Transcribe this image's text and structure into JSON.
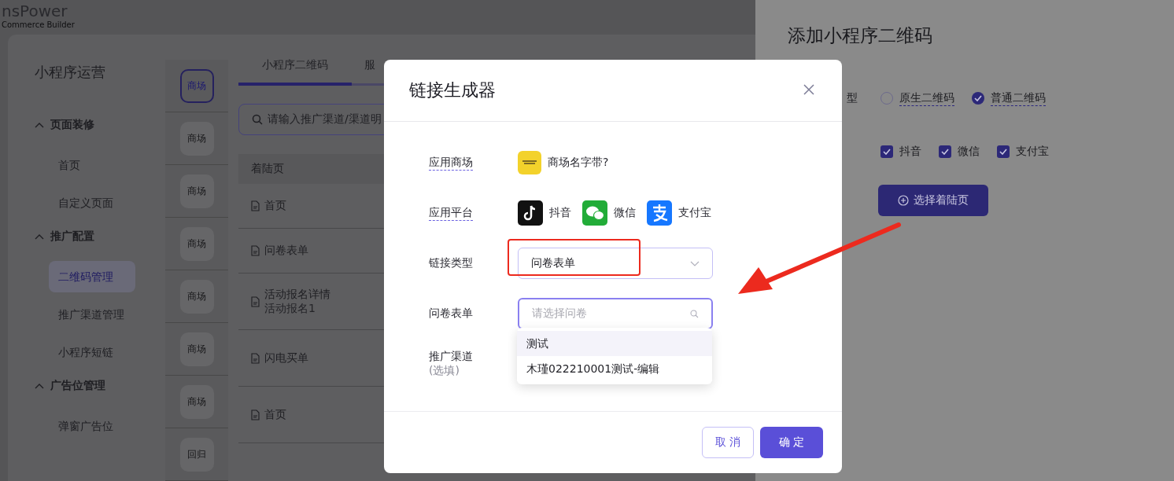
{
  "logo": {
    "name": "nsPower",
    "tagline": "Commerce Builder"
  },
  "sidebar": {
    "title": "小程序运营",
    "groups": [
      {
        "label": "页面装修",
        "expanded": true,
        "children": [
          {
            "label": "首页",
            "selected": false
          },
          {
            "label": "自定义页面",
            "selected": false
          }
        ]
      },
      {
        "label": "推广配置",
        "expanded": true,
        "children": [
          {
            "label": "二维码管理",
            "selected": true
          },
          {
            "label": "推广渠道管理",
            "selected": false
          },
          {
            "label": "小程序短链",
            "selected": false
          }
        ]
      },
      {
        "label": "广告位管理",
        "expanded": true,
        "children": [
          {
            "label": "弹窗广告位",
            "selected": false
          }
        ]
      }
    ]
  },
  "stores": [
    {
      "label": "商场",
      "selected": true
    },
    {
      "label": "商场",
      "selected": false
    },
    {
      "label": "商场",
      "selected": false
    },
    {
      "label": "商场",
      "selected": false
    },
    {
      "label": "商场",
      "selected": false
    },
    {
      "label": "商场",
      "selected": false
    },
    {
      "label": "商场",
      "selected": false
    },
    {
      "label": "回归",
      "selected": false
    }
  ],
  "tabs": [
    {
      "label": "小程序二维码",
      "selected": true
    },
    {
      "label": "服",
      "selected": false
    }
  ],
  "search": {
    "placeholder": "请输入推广渠道/渠道明"
  },
  "table": {
    "columns": [
      "着陆页"
    ],
    "rows": [
      {
        "title": "首页"
      },
      {
        "title": "问卷表单"
      },
      {
        "title": "活动报名详情",
        "subtitle": "活动报名1"
      },
      {
        "title": "闪电买单"
      },
      {
        "title": "首页"
      }
    ]
  },
  "drawer": {
    "title": "添加小程序二维码",
    "type_label": "型",
    "qr_types": [
      {
        "label": "原生二维码",
        "selected": false
      },
      {
        "label": "普通二维码",
        "selected": true
      }
    ],
    "platforms": [
      {
        "label": "抖音",
        "checked": true
      },
      {
        "label": "微信",
        "checked": true
      },
      {
        "label": "支付宝",
        "checked": true
      }
    ],
    "button": "选择着陆页"
  },
  "dialog": {
    "title": "链接生成器",
    "fields": [
      {
        "kind": "store",
        "label": "应用商场",
        "value": "商场名字带?"
      },
      {
        "kind": "platforms",
        "label": "应用平台",
        "platforms": [
          {
            "kind": "douyin",
            "label": "抖音"
          },
          {
            "kind": "wechat",
            "label": "微信"
          },
          {
            "kind": "alipay",
            "label": "支付宝"
          }
        ]
      },
      {
        "kind": "select",
        "label": "链接类型",
        "value": "问卷表单"
      },
      {
        "kind": "search",
        "label": "问卷表单",
        "placeholder": "请选择问卷"
      },
      {
        "kind": "optional",
        "label": "推广渠道",
        "note": "(选填)"
      }
    ],
    "options": [
      {
        "label": "测试",
        "selected": true
      },
      {
        "label": "木瑾022210001测试-编辑",
        "selected": false
      }
    ],
    "buttons": [
      {
        "kind": "secondary",
        "label": "取 消"
      },
      {
        "kind": "primary",
        "label": "确 定"
      }
    ]
  }
}
